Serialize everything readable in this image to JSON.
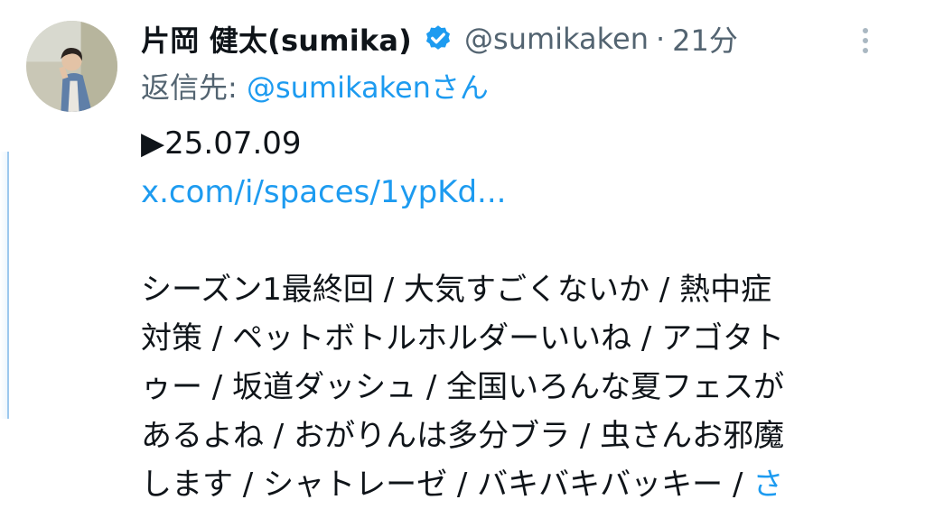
{
  "author": {
    "display_name": "片岡 健太(sumika)",
    "handle": "@sumikaken",
    "separator": "·",
    "time": "21分"
  },
  "reply_to": {
    "prefix": "返信先: ",
    "mention": "@sumikakenさん"
  },
  "tweet": {
    "date_line": "▶25.07.09",
    "link": "x.com/i/spaces/1ypKd...",
    "text_lines": [
      "シーズン1最終回 / 大気すごくないか / 熱中症",
      "対策 / ペットボトルホルダーいいね / アゴタト",
      "ゥー / 坂道ダッシュ / 全国いろんな夏フェスが",
      "あるよね / おがりんは多分ブラ / 虫さんお邪魔"
    ],
    "last_line": "します / シャトレーゼ / バキバキバッキー / ",
    "last_line_link": "さ"
  },
  "icons": {
    "verified": "verified-badge-icon",
    "more": "more-vertical-icon"
  },
  "colors": {
    "accent": "#1d9bf0",
    "muted": "#536471",
    "text": "#0f1419"
  }
}
